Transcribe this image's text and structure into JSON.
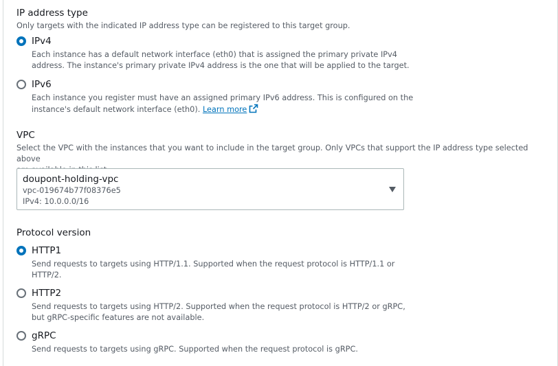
{
  "ip_address_type": {
    "title": "IP address type",
    "description": "Only targets with the indicated IP address type can be registered to this target group.",
    "options": [
      {
        "label": "IPv4",
        "checked": true,
        "desc_line1": "Each instance has a default network interface (eth0) that is assigned the primary private IPv4",
        "desc_line2": "address. The instance's primary private IPv4 address is the one that will be applied to the target."
      },
      {
        "label": "IPv6",
        "checked": false,
        "desc_line1": "Each instance you register must have an assigned primary IPv6 address. This is configured on the",
        "desc_line2": "instance's default network interface (eth0).",
        "link_text": "Learn more",
        "link_icon": "external-link-icon"
      }
    ]
  },
  "vpc": {
    "title": "VPC",
    "desc_line1": "Select the VPC with the instances that you want to include in the target group. Only VPCs that support the IP address type selected above",
    "desc_line2": "are available in this list.",
    "selected": {
      "name": "doupont-holding-vpc",
      "id": "vpc-019674b77f08376e5",
      "cidr": "IPv4: 10.0.0.0/16"
    },
    "caret_icon": "caret-down-icon"
  },
  "protocol_version": {
    "title": "Protocol version",
    "options": [
      {
        "label": "HTTP1",
        "checked": true,
        "desc_line1": "Send requests to targets using HTTP/1.1. Supported when the request protocol is HTTP/1.1 or",
        "desc_line2": "HTTP/2."
      },
      {
        "label": "HTTP2",
        "checked": false,
        "desc_line1": "Send requests to targets using HTTP/2. Supported when the request protocol is HTTP/2 or gRPC,",
        "desc_line2": "but gRPC-specific features are not available."
      },
      {
        "label": "gRPC",
        "checked": false,
        "desc_line1": "Send requests to targets using gRPC. Supported when the request protocol is gRPC."
      }
    ]
  },
  "colors": {
    "accent": "#0073bb",
    "text": "#16191f",
    "secondary_text": "#545b64",
    "border": "#aab7b8"
  }
}
